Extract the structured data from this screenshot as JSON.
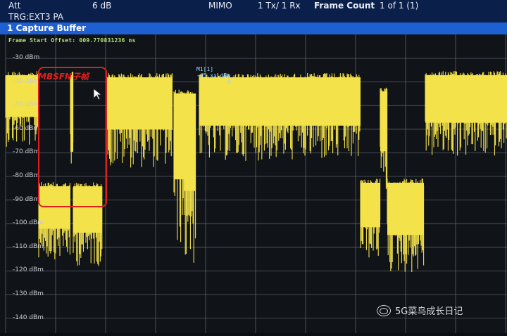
{
  "header": {
    "att_label": "Att",
    "att_value": "6 dB",
    "mode": "MIMO",
    "txrx": "1 Tx/ 1 Rx",
    "frame_count_label": "Frame Count",
    "frame_count_value": "1 of 1 (1)",
    "trigger": "TRG:EXT3 PA"
  },
  "panel": {
    "title": "1 Capture Buffer",
    "frame_offset": "Frame Start Offset: 009.770831236 ns"
  },
  "y_axis_labels": [
    "-30 dBm",
    "-40 dBm",
    "-50 dBm",
    "-60 dBm",
    "-70 dBm",
    "-80 dBm",
    "-90 dBm",
    "-100 dBm",
    "-110 dBm",
    "-120 dBm",
    "-130 dBm",
    "-140 dBm"
  ],
  "marker": {
    "line1": "M1[1]",
    "line2": "-45.xx dBm",
    "line3": "0"
  },
  "annotation": {
    "text": "MBSFN子帧"
  },
  "watermark": {
    "text": "5G菜鸟成长日记"
  },
  "colors": {
    "trace": "#f4e24a",
    "grid": "#5a616b",
    "title_bar": "#1e5fd1",
    "highlight": "#e02020"
  }
}
